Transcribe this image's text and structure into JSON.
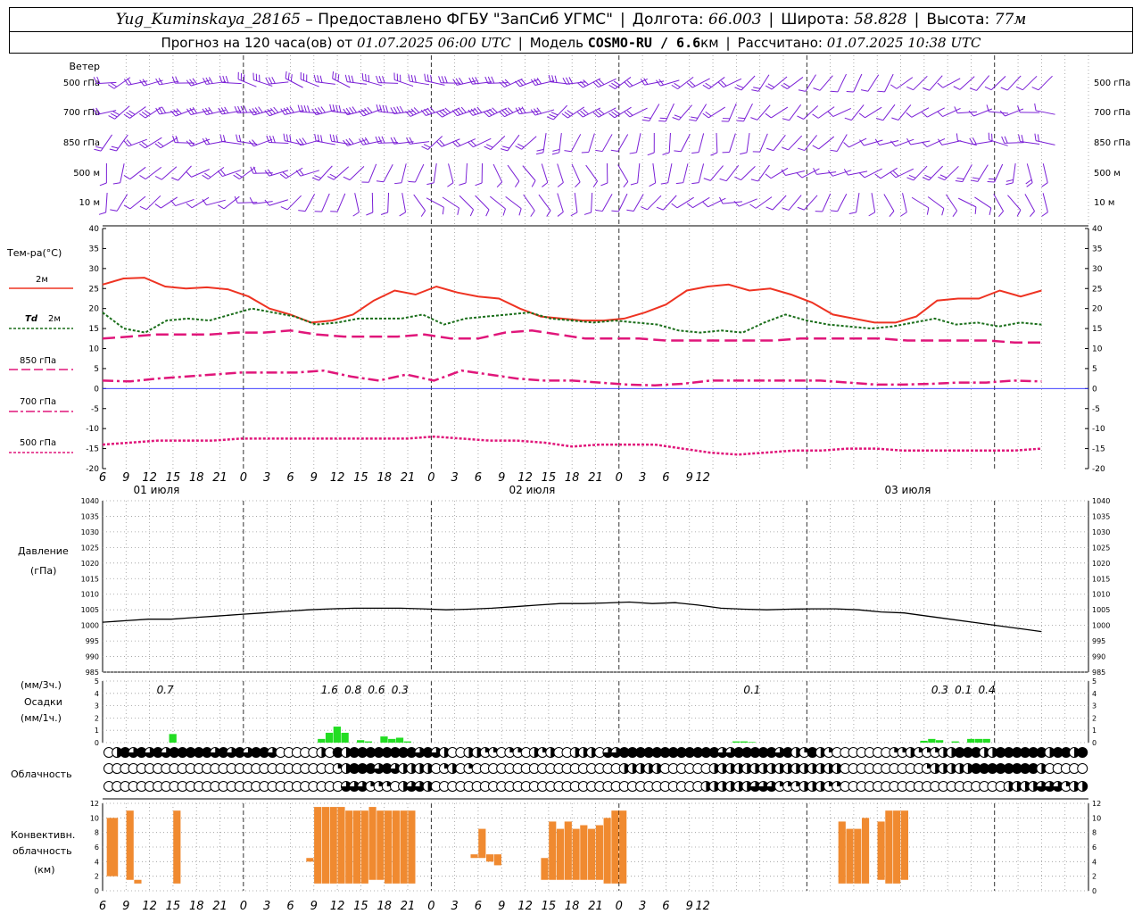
{
  "header": {
    "station": "Yug_Kuminskaya_28165",
    "provider": "– Предоставлено ФГБУ \"ЗапСиб УГМС\"",
    "lon_label": "Долгота:",
    "lon": "66.003",
    "lat_label": "Широта:",
    "lat": "58.828",
    "alt_label": "Высота:",
    "alt": "77м",
    "forecast_prefix": "Прогноз на 120 часа(ов) от",
    "forecast_time": "01.07.2025 06:00 UTC",
    "model_label": "Модель",
    "model": "COSMO-RU / 6.6",
    "model_unit": "км",
    "calc_label": "Рассчитано:",
    "calc_time": "01.07.2025 10:38 UTC"
  },
  "labels": {
    "wind": "Ветер",
    "wind_levels": [
      "500 гПа",
      "700 гПа",
      "850 гПа",
      "500 м",
      "10  м"
    ],
    "temp": "Тем-ра(°С)",
    "leg_2m": "2м",
    "leg_td_a": "Td",
    "leg_td_b": "2м",
    "leg_850": "850 гПа",
    "leg_700": "700 гПа",
    "leg_500": "500 гПа",
    "pressure_a": "Давление",
    "pressure_b": "(гПа)",
    "precip_a": "(мм/3ч.)",
    "precip_b": "Осадки",
    "precip_c": "(мм/1ч.)",
    "cloud": "Облачность",
    "conv_a": "Конвективн.",
    "conv_b": "облачность",
    "conv_c": "(км)"
  },
  "colors": {
    "wind": "#7a1fd6",
    "t2m": "#ee3322",
    "td2m": "#1a6e1a",
    "t_levels": "#e0167a",
    "pressure": "#000000",
    "precip": "#22dd22",
    "conv": "#f08a30",
    "zero_line": "#2222ff"
  },
  "chart_data": [
    {
      "type": "line",
      "title": "Тем-ра(°С)",
      "x_hours": [
        0,
        1.5,
        3,
        4.5,
        6,
        9,
        12,
        15,
        18,
        21,
        24,
        27,
        30,
        33,
        36,
        39,
        42,
        45,
        48,
        51,
        54,
        57,
        60,
        63,
        66,
        69,
        72,
        75,
        78,
        81,
        84,
        87,
        90,
        93,
        96,
        99,
        102,
        105,
        108,
        111,
        114,
        117,
        120
      ],
      "ylim": [
        -20,
        40
      ],
      "yticks": [
        40,
        35,
        30,
        25,
        20,
        15,
        10,
        5,
        0,
        -5,
        -10,
        -15,
        -20
      ],
      "x_tick_labels": [
        "6",
        "9",
        "12",
        "15",
        "18",
        "21",
        "0",
        "3",
        "6",
        "9",
        "12",
        "15",
        "18",
        "21",
        "0",
        "3",
        "6",
        "9",
        "12",
        "15",
        "18",
        "21",
        "0",
        "3",
        "6",
        "9",
        "12"
      ],
      "day_labels": [
        "01 июля",
        "02 июля",
        "03 июля"
      ],
      "series": [
        {
          "name": "2м",
          "values": [
            26,
            27.5,
            27.7,
            25.5,
            25,
            25.3,
            24.8,
            23,
            20,
            18.5,
            16.5,
            17,
            18.5,
            22,
            24.5,
            23.5,
            25.5,
            24,
            23,
            22.5,
            20,
            18,
            17.5,
            17,
            17,
            17.5,
            19,
            21,
            24.5,
            25.5,
            26,
            24.5,
            25,
            23.5,
            21.5,
            18.5,
            17.5,
            16.5,
            16.5,
            18,
            22,
            22.5,
            22.5,
            24.5,
            23,
            24.5
          ]
        },
        {
          "name": "Td 2м",
          "values": [
            19,
            15,
            14,
            17,
            17.5,
            17,
            18.5,
            20,
            19,
            18,
            16,
            16.5,
            17.5,
            17.5,
            17.5,
            18.5,
            16,
            17.5,
            18,
            18.5,
            19,
            17.5,
            17,
            16.5,
            17,
            16.5,
            16,
            14.5,
            14,
            14.5,
            14,
            16.5,
            18.5,
            17,
            16,
            15.5,
            15,
            15.5,
            16.5,
            17.5,
            16,
            16.5,
            15.5,
            16.5,
            16
          ]
        },
        {
          "name": "850 гПа",
          "values": [
            12.5,
            13,
            13.5,
            13.5,
            13.5,
            14,
            14,
            14.5,
            13.5,
            13,
            13,
            13,
            13.5,
            12.5,
            12.5,
            14,
            14.5,
            13.5,
            12.5,
            12.5,
            12.5,
            12,
            12,
            12,
            12,
            12,
            12.5,
            12.5,
            12.5,
            12.5,
            12,
            12,
            12,
            12,
            11.5,
            11.5
          ]
        },
        {
          "name": "700 гПа",
          "values": [
            2,
            1.8,
            2.5,
            3,
            3.5,
            4,
            4,
            4,
            4.5,
            3,
            2,
            3.5,
            2,
            4.5,
            3.5,
            2.5,
            2,
            2,
            1.5,
            1,
            0.8,
            1.2,
            2,
            2,
            2,
            2,
            2,
            1.5,
            1,
            1,
            1.2,
            1.5,
            1.5,
            2,
            1.8
          ]
        },
        {
          "name": "500 гПа",
          "values": [
            -14,
            -13.5,
            -13,
            -13,
            -13,
            -12.5,
            -12.5,
            -12.5,
            -12.5,
            -12.5,
            -12.5,
            -12.5,
            -12,
            -12.5,
            -13,
            -13,
            -13.5,
            -14.5,
            -14,
            -14,
            -14,
            -15,
            -16,
            -16.5,
            -16,
            -15.5,
            -15.5,
            -15,
            -15,
            -15.5,
            -15.5,
            -15.5,
            -15.5,
            -15.5,
            -15
          ]
        }
      ]
    },
    {
      "type": "line",
      "title": "Давление",
      "ylabel": "(гПа)",
      "ylim": [
        985,
        1040
      ],
      "yticks": [
        1040,
        1035,
        1030,
        1025,
        1020,
        1015,
        1010,
        1005,
        1000,
        995,
        990,
        985
      ],
      "series": [
        {
          "name": "Давление",
          "values": [
            1001,
            1001.5,
            1002,
            1002,
            1002.5,
            1003,
            1003.5,
            1004,
            1004.5,
            1005,
            1005.3,
            1005.5,
            1005.5,
            1005.5,
            1005.3,
            1005,
            1005.2,
            1005.5,
            1006,
            1006.5,
            1007,
            1007,
            1007.2,
            1007.5,
            1007,
            1007.3,
            1006.5,
            1005.5,
            1005.2,
            1005,
            1005.2,
            1005.3,
            1005.3,
            1005,
            1004.3,
            1004,
            1003,
            1002,
            1001,
            1000,
            999,
            998
          ]
        }
      ]
    },
    {
      "type": "bar",
      "title": "Осадки",
      "ylabel": "(мм/1ч.)",
      "ylim": [
        0,
        5
      ],
      "yticks": [
        0,
        1,
        2,
        3,
        4,
        5
      ],
      "values_hourly": [
        {
          "h": 9,
          "v": 0.7
        },
        {
          "h": 28,
          "v": 0.3
        },
        {
          "h": 29,
          "v": 0.8
        },
        {
          "h": 30,
          "v": 1.3
        },
        {
          "h": 31,
          "v": 0.8
        },
        {
          "h": 33,
          "v": 0.2
        },
        {
          "h": 34,
          "v": 0.1
        },
        {
          "h": 36,
          "v": 0.5
        },
        {
          "h": 37,
          "v": 0.3
        },
        {
          "h": 38,
          "v": 0.4
        },
        {
          "h": 39,
          "v": 0.1
        },
        {
          "h": 81,
          "v": 0.1
        },
        {
          "h": 82,
          "v": 0.1
        },
        {
          "h": 83,
          "v": 0.05
        },
        {
          "h": 105,
          "v": 0.15
        },
        {
          "h": 106,
          "v": 0.3
        },
        {
          "h": 107,
          "v": 0.2
        },
        {
          "h": 109,
          "v": 0.1
        },
        {
          "h": 111,
          "v": 0.3
        },
        {
          "h": 112,
          "v": 0.3
        },
        {
          "h": 113,
          "v": 0.3
        }
      ],
      "labels_3h": [
        {
          "h": 9,
          "text": "0.7"
        },
        {
          "h": 30,
          "text": "1.6"
        },
        {
          "h": 33,
          "text": "0.8"
        },
        {
          "h": 36,
          "text": "0.6"
        },
        {
          "h": 39,
          "text": "0.3"
        },
        {
          "h": 84,
          "text": "0.1"
        },
        {
          "h": 108,
          "text": "0.3"
        },
        {
          "h": 111,
          "text": "0.1"
        },
        {
          "h": 114,
          "text": "0.4"
        }
      ]
    },
    {
      "type": "table",
      "title": "Облачность",
      "rows": [
        "upper",
        "middle",
        "lower"
      ],
      "cover_per_hour_upper": [
        0,
        2,
        4,
        3,
        4,
        3,
        4,
        3,
        4,
        4,
        4,
        4,
        4,
        3,
        4,
        3,
        4,
        3,
        4,
        4,
        3,
        0,
        0,
        0,
        0,
        0,
        2,
        0,
        4,
        2,
        4,
        4,
        4,
        4,
        4,
        4,
        4,
        4,
        3,
        4,
        3,
        2,
        0,
        0,
        2,
        2,
        1,
        1,
        0,
        1,
        1,
        0,
        2,
        1,
        2,
        0,
        0,
        2,
        2,
        2,
        0,
        3,
        3,
        4,
        4,
        4,
        4,
        4,
        4,
        4,
        4,
        4,
        4,
        4,
        4,
        3,
        3,
        4,
        4,
        4,
        4,
        4,
        3,
        4,
        2,
        1,
        4,
        2,
        1,
        0,
        0,
        0,
        0,
        0,
        0,
        0,
        1,
        1,
        2,
        1,
        1,
        1,
        2,
        2,
        4,
        4,
        4,
        2,
        2,
        4,
        4,
        4,
        4,
        4,
        4,
        2,
        4,
        4,
        2,
        4
      ],
      "cover_per_hour_middle": [
        0,
        0,
        0,
        0,
        0,
        0,
        0,
        0,
        0,
        0,
        0,
        0,
        0,
        0,
        0,
        0,
        0,
        0,
        0,
        0,
        0,
        0,
        0,
        0,
        0,
        0,
        0,
        0,
        1,
        2,
        4,
        4,
        4,
        3,
        4,
        3,
        2,
        2,
        2,
        2,
        0,
        1,
        2,
        0,
        1,
        0,
        0,
        0,
        0,
        0,
        0,
        0,
        0,
        0,
        0,
        0,
        0,
        0,
        0,
        0,
        0,
        0,
        0,
        2,
        2,
        2,
        2,
        2,
        0,
        0,
        0,
        0,
        0,
        0,
        2,
        2,
        2,
        2,
        2,
        2,
        2,
        2,
        2,
        2,
        2,
        2,
        2,
        2,
        2,
        2,
        0,
        0,
        0,
        0,
        0,
        0,
        0,
        0,
        0,
        0,
        1,
        2,
        2,
        2,
        2,
        2,
        4,
        4,
        4,
        4,
        4,
        4,
        4,
        4,
        2,
        0,
        0,
        0,
        0,
        0
      ],
      "cover_per_hour_lower": [
        0,
        0,
        0,
        0,
        0,
        0,
        0,
        0,
        0,
        0,
        0,
        0,
        0,
        0,
        0,
        0,
        0,
        0,
        0,
        0,
        0,
        0,
        0,
        0,
        0,
        0,
        0,
        0,
        0,
        3,
        3,
        3,
        1,
        1,
        1,
        0,
        2,
        3,
        3,
        2,
        0,
        0,
        0,
        0,
        0,
        0,
        0,
        0,
        0,
        0,
        0,
        0,
        0,
        0,
        0,
        0,
        0,
        0,
        0,
        0,
        0,
        0,
        0,
        0,
        0,
        0,
        0,
        0,
        0,
        0,
        0,
        0,
        0,
        2,
        2,
        2,
        2,
        2,
        2,
        3,
        3,
        3,
        1,
        1,
        1,
        2,
        2,
        2,
        1,
        1,
        0,
        0,
        0,
        0,
        0,
        0,
        0,
        0,
        0,
        0,
        0,
        0,
        0,
        0,
        0,
        0,
        0,
        0,
        0,
        0,
        2,
        2,
        2,
        2,
        3,
        3,
        3,
        1,
        2,
        2
      ]
    },
    {
      "type": "bar",
      "title": "Конвективн. облачность",
      "ylabel": "(км)",
      "ylim": [
        0,
        12
      ],
      "yticks": [
        0,
        2,
        4,
        6,
        8,
        10,
        12
      ],
      "x_tick_labels": [
        "6",
        "9",
        "12",
        "15",
        "18",
        "21",
        "0",
        "3",
        "6",
        "9",
        "12",
        "15",
        "18",
        "21",
        "0",
        "3",
        "6",
        "9",
        "12",
        "15",
        "18",
        "21",
        "0",
        "3",
        "6",
        "9",
        "12"
      ],
      "segments": [
        {
          "h0": 0.5,
          "h1": 2,
          "base": 2,
          "top": 10
        },
        {
          "h0": 3,
          "h1": 4,
          "base": 1.5,
          "top": 11
        },
        {
          "h0": 4,
          "h1": 5,
          "base": 1,
          "top": 1.5
        },
        {
          "h0": 9,
          "h1": 10,
          "base": 1,
          "top": 11
        },
        {
          "h0": 26,
          "h1": 27,
          "base": 4,
          "top": 4.5
        },
        {
          "h0": 27,
          "h1": 28,
          "base": 1,
          "top": 11.5
        },
        {
          "h0": 28,
          "h1": 29,
          "base": 1,
          "top": 11.5
        },
        {
          "h0": 29,
          "h1": 30,
          "base": 1,
          "top": 11.5
        },
        {
          "h0": 30,
          "h1": 31,
          "base": 1,
          "top": 11.5
        },
        {
          "h0": 31,
          "h1": 32,
          "base": 1,
          "top": 11
        },
        {
          "h0": 32,
          "h1": 33,
          "base": 1,
          "top": 11
        },
        {
          "h0": 33,
          "h1": 34,
          "base": 1,
          "top": 11
        },
        {
          "h0": 34,
          "h1": 35,
          "base": 1.5,
          "top": 11.5
        },
        {
          "h0": 35,
          "h1": 36,
          "base": 1.5,
          "top": 11
        },
        {
          "h0": 36,
          "h1": 37,
          "base": 1,
          "top": 11
        },
        {
          "h0": 37,
          "h1": 38,
          "base": 1,
          "top": 11
        },
        {
          "h0": 38,
          "h1": 39,
          "base": 1,
          "top": 11
        },
        {
          "h0": 39,
          "h1": 40,
          "base": 1,
          "top": 11
        },
        {
          "h0": 47,
          "h1": 48,
          "base": 4.5,
          "top": 5
        },
        {
          "h0": 48,
          "h1": 49,
          "base": 4.5,
          "top": 8.5
        },
        {
          "h0": 49,
          "h1": 50,
          "base": 4,
          "top": 5
        },
        {
          "h0": 50,
          "h1": 51,
          "base": 3.5,
          "top": 5
        },
        {
          "h0": 56,
          "h1": 57,
          "base": 1.5,
          "top": 4.5
        },
        {
          "h0": 57,
          "h1": 58,
          "base": 1.5,
          "top": 9.5
        },
        {
          "h0": 58,
          "h1": 59,
          "base": 1.5,
          "top": 8.5
        },
        {
          "h0": 59,
          "h1": 60,
          "base": 1.5,
          "top": 9.5
        },
        {
          "h0": 60,
          "h1": 61,
          "base": 1.5,
          "top": 8.5
        },
        {
          "h0": 61,
          "h1": 62,
          "base": 1.5,
          "top": 9
        },
        {
          "h0": 62,
          "h1": 63,
          "base": 1.5,
          "top": 8.5
        },
        {
          "h0": 63,
          "h1": 64,
          "base": 1.5,
          "top": 9
        },
        {
          "h0": 64,
          "h1": 65,
          "base": 1,
          "top": 10
        },
        {
          "h0": 65,
          "h1": 66,
          "base": 1,
          "top": 11
        },
        {
          "h0": 66,
          "h1": 67,
          "base": 1,
          "top": 11
        },
        {
          "h0": 94,
          "h1": 95,
          "base": 1,
          "top": 9.5
        },
        {
          "h0": 95,
          "h1": 96,
          "base": 1,
          "top": 8.5
        },
        {
          "h0": 96,
          "h1": 97,
          "base": 1,
          "top": 8.5
        },
        {
          "h0": 97,
          "h1": 98,
          "base": 1,
          "top": 10
        },
        {
          "h0": 99,
          "h1": 100,
          "base": 1.5,
          "top": 9.5
        },
        {
          "h0": 100,
          "h1": 101,
          "base": 1,
          "top": 11
        },
        {
          "h0": 101,
          "h1": 102,
          "base": 1,
          "top": 11
        },
        {
          "h0": 102,
          "h1": 103,
          "base": 1.5,
          "top": 11
        }
      ]
    }
  ]
}
